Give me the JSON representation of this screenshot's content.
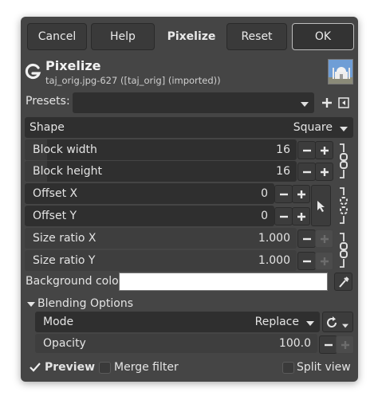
{
  "buttons": {
    "cancel": "Cancel",
    "help": "Help",
    "active_filter": "Pixelize",
    "reset": "Reset",
    "ok": "OK"
  },
  "header": {
    "title": "Pixelize",
    "subtitle": "taj_orig.jpg-627 ([taj_orig] (imported))",
    "logo_icon": "gegl-logo-icon",
    "thumbnail_icon": "taj-mahal-thumbnail"
  },
  "presets": {
    "label": "Presets:",
    "value": ""
  },
  "shape": {
    "label": "Shape",
    "value": "Square"
  },
  "block_width": {
    "label": "Block width",
    "value": "16"
  },
  "block_height": {
    "label": "Block height",
    "value": "16"
  },
  "offset_x": {
    "label": "Offset X",
    "value": "0"
  },
  "offset_y": {
    "label": "Offset Y",
    "value": "0"
  },
  "size_ratio_x": {
    "label": "Size ratio X",
    "value": "1.000",
    "fill": 1.0
  },
  "size_ratio_y": {
    "label": "Size ratio Y",
    "value": "1.000",
    "fill": 1.0
  },
  "background_color": {
    "label": "Background color",
    "color": "#ffffff"
  },
  "blending": {
    "section_label": "Blending Options",
    "mode_label": "Mode",
    "mode_value": "Replace",
    "opacity_label": "Opacity",
    "opacity_value": "100.0"
  },
  "footer": {
    "preview_label": "Preview",
    "preview_checked": true,
    "merge_label": "Merge filter",
    "merge_checked": false,
    "split_label": "Split view",
    "split_checked": false
  },
  "colors": {
    "dialog_bg": "#454545",
    "field_bg": "#2f2f2f",
    "text": "#e4e4e4"
  }
}
